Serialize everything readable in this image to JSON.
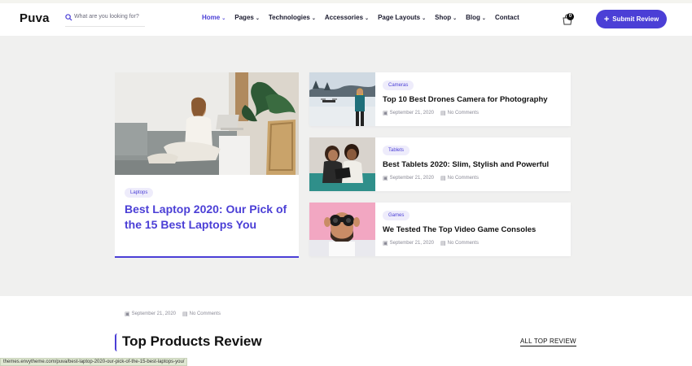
{
  "header": {
    "logo": "Puva",
    "search_placeholder": "What are you looking for?",
    "nav": [
      {
        "label": "Home",
        "chevron": "⌄",
        "active": true
      },
      {
        "label": "Pages",
        "chevron": "⌄"
      },
      {
        "label": "Technologies",
        "chevron": "⌄"
      },
      {
        "label": "Accessories",
        "chevron": "⌄"
      },
      {
        "label": "Page Layouts",
        "chevron": "⌄"
      },
      {
        "label": "Shop",
        "chevron": "⌄"
      },
      {
        "label": "Blog",
        "chevron": "⌄"
      },
      {
        "label": "Contact",
        "chevron": ""
      }
    ],
    "cart_count": "0",
    "submit_icon": "+",
    "submit_label": "Submit Review"
  },
  "featured": {
    "tag": "Laptops",
    "title": "Best Laptop 2020: Our Pick of the 15 Best Laptops You",
    "date": "September 21, 2020",
    "comments": "No Comments"
  },
  "posts": [
    {
      "tag": "Cameras",
      "title": "Top 10 Best Drones Camera for Photography",
      "date": "September 21, 2020",
      "comments": "No Comments"
    },
    {
      "tag": "Tablets",
      "title": "Best Tablets 2020: Slim, Stylish and Powerful",
      "date": "September 21, 2020",
      "comments": "No Comments"
    },
    {
      "tag": "Games",
      "title": "We Tested The Top Video Game Consoles",
      "date": "September 21, 2020",
      "comments": "No Comments"
    }
  ],
  "section": {
    "title": "Top Products Review",
    "link": "ALL TOP REVIEW"
  },
  "status_url": "themes.envytheme.com/puva/best-laptop-2020-our-pick-of-the-15-best-laptops-you/",
  "icons": {
    "calendar": "▣",
    "comment": "▤"
  },
  "colors": {
    "accent": "#4b3fd6",
    "tag_bg": "#eeecfb",
    "band": "#f0f0ef"
  }
}
